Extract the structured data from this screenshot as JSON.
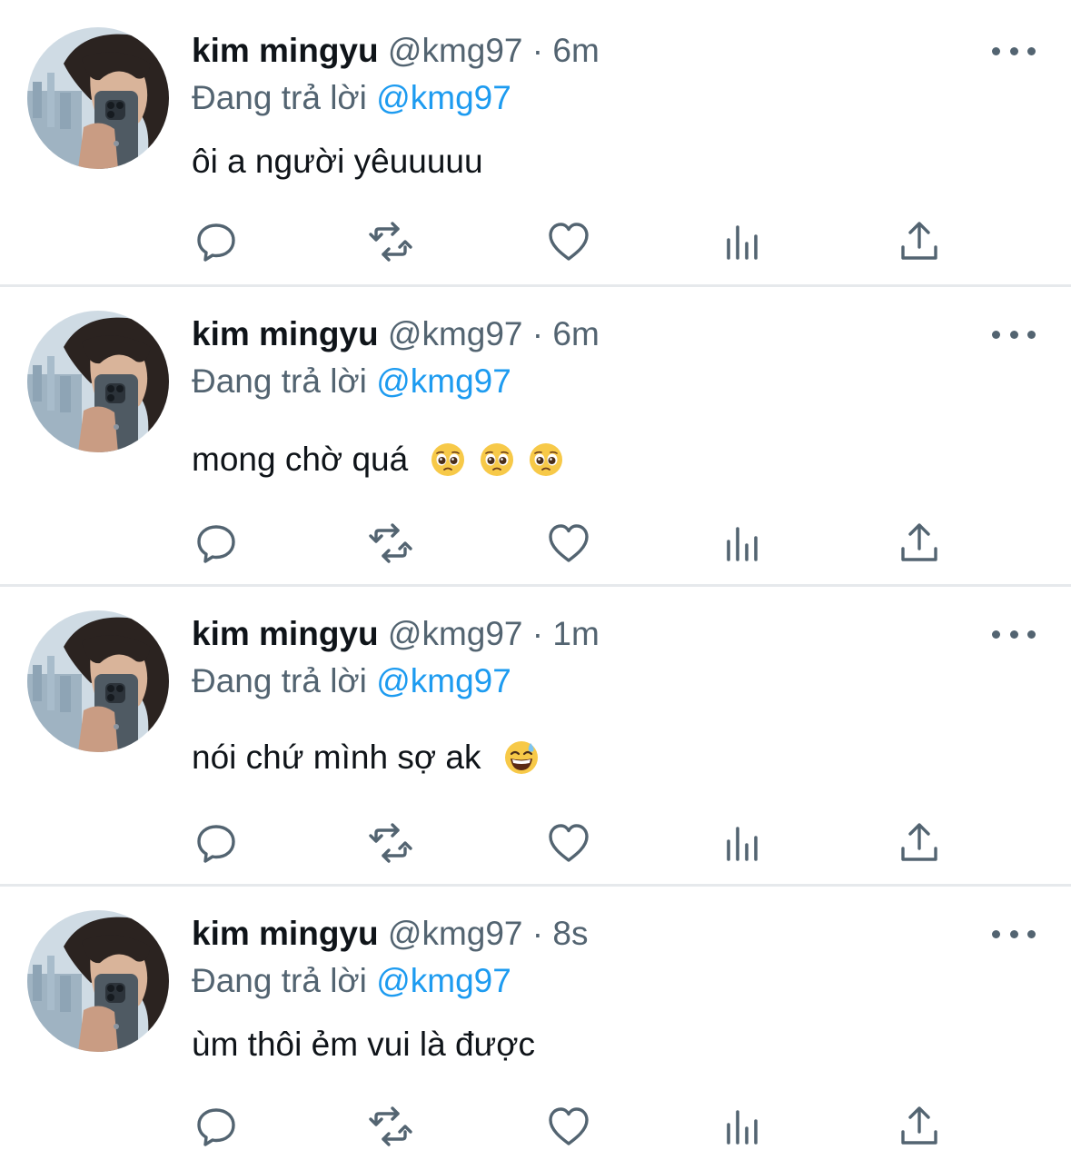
{
  "tweets": [
    {
      "name": "kim mingyu",
      "handle": "@kmg97",
      "sep": "·",
      "time": "6m",
      "replying_label": "Đang trả lời",
      "replying_to": "@kmg97",
      "text": "ôi a người yêuuuuu",
      "emojis": []
    },
    {
      "name": "kim mingyu",
      "handle": "@kmg97",
      "sep": "·",
      "time": "6m",
      "replying_label": "Đang trả lời",
      "replying_to": "@kmg97",
      "text": "mong chờ quá",
      "emojis": [
        "pleading-face",
        "pleading-face",
        "pleading-face"
      ]
    },
    {
      "name": "kim mingyu",
      "handle": "@kmg97",
      "sep": "·",
      "time": "1m",
      "replying_label": "Đang trả lời",
      "replying_to": "@kmg97",
      "text": "nói chứ mình sợ ak",
      "emojis": [
        "grinning-sweat-face"
      ]
    },
    {
      "name": "kim mingyu",
      "handle": "@kmg97",
      "sep": "·",
      "time": "8s",
      "replying_label": "Đang trả lời",
      "replying_to": "@kmg97",
      "text": "ùm thôi ẻm vui là được",
      "emojis": []
    }
  ],
  "icons": {
    "actions": [
      "reply-icon",
      "retweet-icon",
      "like-icon",
      "views-icon",
      "share-icon"
    ],
    "more": "more-options-icon"
  },
  "colors": {
    "text": "#0f1419",
    "secondary": "#536471",
    "link": "#1d9bf0",
    "divider": "#e6e9ec"
  }
}
